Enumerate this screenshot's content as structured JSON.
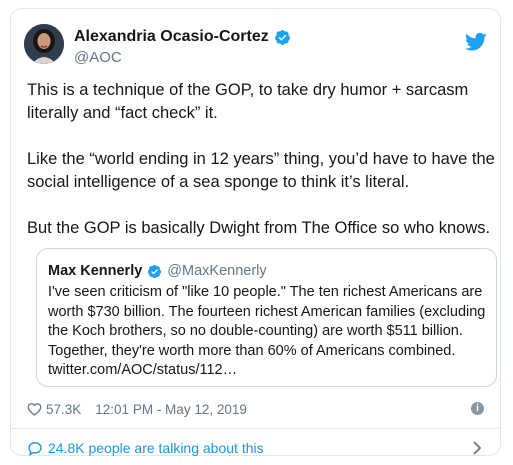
{
  "author": {
    "name": "Alexandria Ocasio-Cortez",
    "handle": "@AOC"
  },
  "tweet": {
    "paragraphs": [
      "This is a technique of the GOP, to take dry humor + sarcasm literally and “fact check” it.",
      "Like the “world ending in 12 years” thing, you’d have to have the social intelligence of a sea sponge to think it’s literal.",
      "But the GOP is basically Dwight from The Office so who knows."
    ]
  },
  "quoted": {
    "name": "Max Kennerly",
    "handle": "@MaxKennerly",
    "text": "I've seen criticism of \"like 10 people.\" The ten richest Americans are worth $730 billion. The fourteen richest American families (excluding the Koch brothers, so no double-counting) are worth $511 billion. Together, they're worth more than 60% of Americans combined. twitter.com/AOC/status/112…"
  },
  "meta": {
    "likes": "57.3K",
    "timestamp": "12:01 PM - May 12, 2019",
    "info": "i"
  },
  "footer": {
    "talking": "24.8K people are talking about this"
  },
  "colors": {
    "twitter_blue": "#1da1f2",
    "link_blue": "#1b95e0",
    "secondary_text": "#657786",
    "border": "#e1e8ed"
  },
  "icons": {
    "verified": "verified-badge-icon",
    "bird": "twitter-bird-icon",
    "heart": "heart-icon",
    "info": "info-icon",
    "bubble": "speech-bubble-icon",
    "chevron": "chevron-right-icon"
  }
}
